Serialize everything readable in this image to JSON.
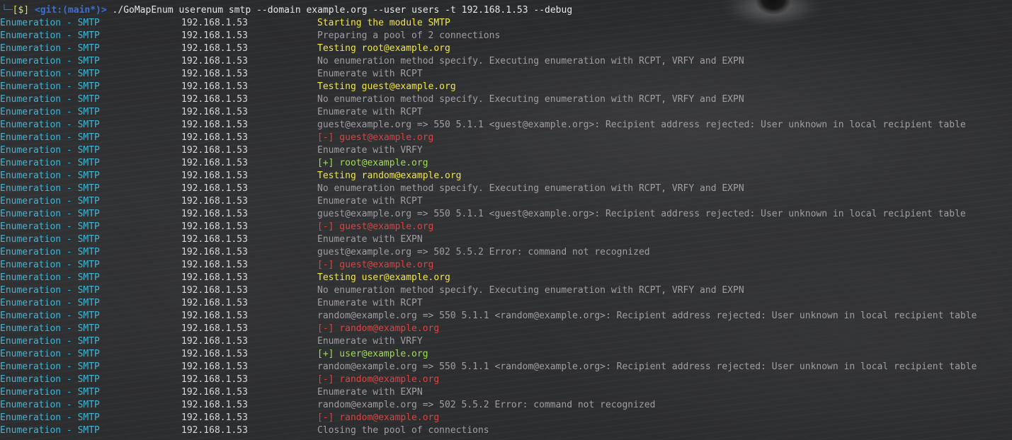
{
  "prompt": {
    "status": "[$]",
    "git": "<git:(main*)>",
    "command": "./GoMapEnum userenum smtp --domain example.org --user users -t 192.168.1.53 --debug"
  },
  "rows": [
    {
      "module": "Enumeration - SMTP",
      "ip": "192.168.1.53",
      "msg": "Starting the module SMTP",
      "color": "yellow"
    },
    {
      "module": "Enumeration - SMTP",
      "ip": "192.168.1.53",
      "msg": "Preparing a pool of 2 connections",
      "color": "gray"
    },
    {
      "module": "Enumeration - SMTP",
      "ip": "192.168.1.53",
      "msg": "Testing root@example.org",
      "color": "yellow"
    },
    {
      "module": "Enumeration - SMTP",
      "ip": "192.168.1.53",
      "msg": "No enumeration method specify. Executing enumeration with RCPT, VRFY and EXPN",
      "color": "gray"
    },
    {
      "module": "Enumeration - SMTP",
      "ip": "192.168.1.53",
      "msg": "Enumerate with RCPT",
      "color": "gray"
    },
    {
      "module": "Enumeration - SMTP",
      "ip": "192.168.1.53",
      "msg": "Testing guest@example.org",
      "color": "yellow"
    },
    {
      "module": "Enumeration - SMTP",
      "ip": "192.168.1.53",
      "msg": "No enumeration method specify. Executing enumeration with RCPT, VRFY and EXPN",
      "color": "gray"
    },
    {
      "module": "Enumeration - SMTP",
      "ip": "192.168.1.53",
      "msg": "Enumerate with RCPT",
      "color": "gray"
    },
    {
      "module": "Enumeration - SMTP",
      "ip": "192.168.1.53",
      "msg": "guest@example.org => 550 5.1.1 <guest@example.org>: Recipient address rejected: User unknown in local recipient table",
      "color": "gray"
    },
    {
      "module": "Enumeration - SMTP",
      "ip": "192.168.1.53",
      "msg": "[-] guest@example.org",
      "color": "red"
    },
    {
      "module": "Enumeration - SMTP",
      "ip": "192.168.1.53",
      "msg": "Enumerate with VRFY",
      "color": "gray"
    },
    {
      "module": "Enumeration - SMTP",
      "ip": "192.168.1.53",
      "msg": "[+] root@example.org",
      "color": "green"
    },
    {
      "module": "Enumeration - SMTP",
      "ip": "192.168.1.53",
      "msg": "Testing random@example.org",
      "color": "yellow"
    },
    {
      "module": "Enumeration - SMTP",
      "ip": "192.168.1.53",
      "msg": "No enumeration method specify. Executing enumeration with RCPT, VRFY and EXPN",
      "color": "gray"
    },
    {
      "module": "Enumeration - SMTP",
      "ip": "192.168.1.53",
      "msg": "Enumerate with RCPT",
      "color": "gray"
    },
    {
      "module": "Enumeration - SMTP",
      "ip": "192.168.1.53",
      "msg": "guest@example.org => 550 5.1.1 <guest@example.org>: Recipient address rejected: User unknown in local recipient table",
      "color": "gray"
    },
    {
      "module": "Enumeration - SMTP",
      "ip": "192.168.1.53",
      "msg": "[-] guest@example.org",
      "color": "red"
    },
    {
      "module": "Enumeration - SMTP",
      "ip": "192.168.1.53",
      "msg": "Enumerate with EXPN",
      "color": "gray"
    },
    {
      "module": "Enumeration - SMTP",
      "ip": "192.168.1.53",
      "msg": "guest@example.org => 502 5.5.2 Error: command not recognized",
      "color": "gray"
    },
    {
      "module": "Enumeration - SMTP",
      "ip": "192.168.1.53",
      "msg": "[-] guest@example.org",
      "color": "red"
    },
    {
      "module": "Enumeration - SMTP",
      "ip": "192.168.1.53",
      "msg": "Testing user@example.org",
      "color": "yellow"
    },
    {
      "module": "Enumeration - SMTP",
      "ip": "192.168.1.53",
      "msg": "No enumeration method specify. Executing enumeration with RCPT, VRFY and EXPN",
      "color": "gray"
    },
    {
      "module": "Enumeration - SMTP",
      "ip": "192.168.1.53",
      "msg": "Enumerate with RCPT",
      "color": "gray"
    },
    {
      "module": "Enumeration - SMTP",
      "ip": "192.168.1.53",
      "msg": "random@example.org => 550 5.1.1 <random@example.org>: Recipient address rejected: User unknown in local recipient table",
      "color": "gray"
    },
    {
      "module": "Enumeration - SMTP",
      "ip": "192.168.1.53",
      "msg": "[-] random@example.org",
      "color": "red"
    },
    {
      "module": "Enumeration - SMTP",
      "ip": "192.168.1.53",
      "msg": "Enumerate with VRFY",
      "color": "gray"
    },
    {
      "module": "Enumeration - SMTP",
      "ip": "192.168.1.53",
      "msg": "[+] user@example.org",
      "color": "green"
    },
    {
      "module": "Enumeration - SMTP",
      "ip": "192.168.1.53",
      "msg": "random@example.org => 550 5.1.1 <random@example.org>: Recipient address rejected: User unknown in local recipient table",
      "color": "gray"
    },
    {
      "module": "Enumeration - SMTP",
      "ip": "192.168.1.53",
      "msg": "[-] random@example.org",
      "color": "red"
    },
    {
      "module": "Enumeration - SMTP",
      "ip": "192.168.1.53",
      "msg": "Enumerate with EXPN",
      "color": "gray"
    },
    {
      "module": "Enumeration - SMTP",
      "ip": "192.168.1.53",
      "msg": "random@example.org => 502 5.5.2 Error: command not recognized",
      "color": "gray"
    },
    {
      "module": "Enumeration - SMTP",
      "ip": "192.168.1.53",
      "msg": "[-] random@example.org",
      "color": "red"
    },
    {
      "module": "Enumeration - SMTP",
      "ip": "192.168.1.53",
      "msg": "Closing the pool of connections",
      "color": "gray"
    }
  ]
}
